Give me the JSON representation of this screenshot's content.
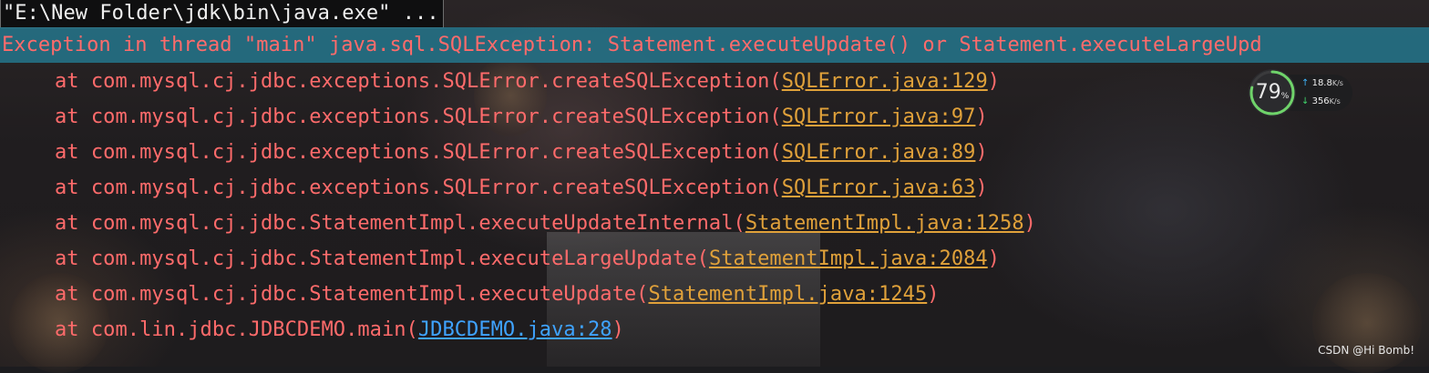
{
  "console": {
    "command_line": "\"E:\\New Folder\\jdk\\bin\\java.exe\" ...",
    "exception_line": "Exception in thread \"main\" java.sql.SQLException: Statement.executeUpdate() or Statement.executeLargeUpd",
    "trace": [
      {
        "prefix": "at com.mysql.cj.jdbc.exceptions.SQLError.createSQLException(",
        "link": "SQLError.java:129",
        "suffix": ")"
      },
      {
        "prefix": "at com.mysql.cj.jdbc.exceptions.SQLError.createSQLException(",
        "link": "SQLError.java:97",
        "suffix": ")"
      },
      {
        "prefix": "at com.mysql.cj.jdbc.exceptions.SQLError.createSQLException(",
        "link": "SQLError.java:89",
        "suffix": ")"
      },
      {
        "prefix": "at com.mysql.cj.jdbc.exceptions.SQLError.createSQLException(",
        "link": "SQLError.java:63",
        "suffix": ")"
      },
      {
        "prefix": "at com.mysql.cj.jdbc.StatementImpl.executeUpdateInternal(",
        "link": "StatementImpl.java:1258",
        "suffix": ")"
      },
      {
        "prefix": "at com.mysql.cj.jdbc.StatementImpl.executeLargeUpdate(",
        "link": "StatementImpl.java:2084",
        "suffix": ")"
      },
      {
        "prefix": "at com.mysql.cj.jdbc.StatementImpl.executeUpdate(",
        "link": "StatementImpl.java:1245",
        "suffix": ")"
      },
      {
        "prefix": "at com.lin.jdbc.JDBCDEMO.main(",
        "link": "JDBCDEMO.java:28",
        "suffix": ")"
      }
    ]
  },
  "net_widget": {
    "cpu_value": "79",
    "cpu_unit": "%",
    "cpu_fraction": 0.79,
    "upload_value": "18.8",
    "upload_unit": "K/s",
    "download_value": "356",
    "download_unit": "K/s"
  },
  "watermark": "CSDN @Hi Bomb!",
  "colors": {
    "error_text": "#ff6b6b",
    "highlight_bg": "#24768c",
    "link_library": "#e0a13a",
    "link_project": "#3fa3ff"
  }
}
